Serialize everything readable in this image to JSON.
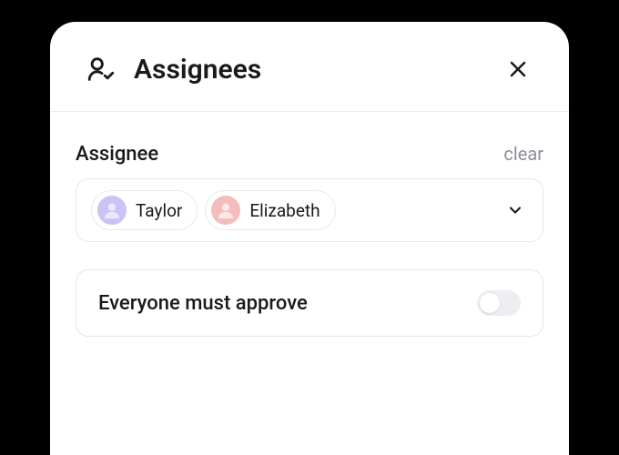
{
  "header": {
    "title": "Assignees"
  },
  "assignee": {
    "label": "Assignee",
    "clear_label": "clear",
    "chips": [
      {
        "name": "Taylor",
        "avatar_color": "purple"
      },
      {
        "name": "Elizabeth",
        "avatar_color": "pink"
      }
    ]
  },
  "approve_toggle": {
    "label": "Everyone must approve",
    "on": false
  }
}
